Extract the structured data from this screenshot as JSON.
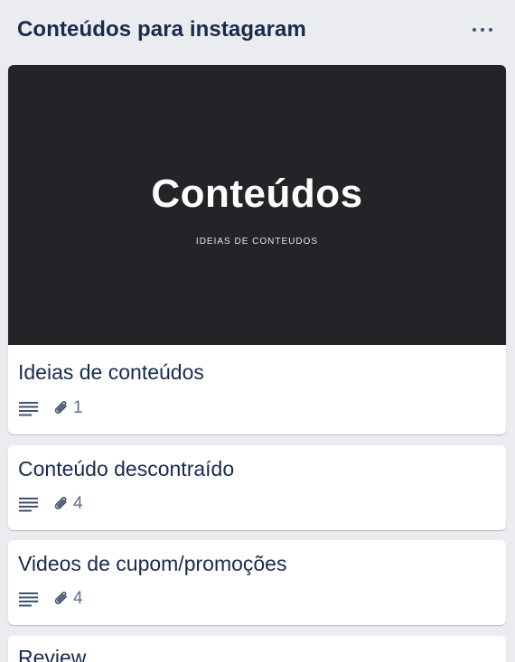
{
  "list": {
    "title": "Conteúdos para instagaram",
    "menu_icon": "more-horizontal-icon"
  },
  "cards": [
    {
      "cover": {
        "title": "Conteúdos",
        "subtitle": "IDEIAS DE CONTEUDOS",
        "background": "#232427"
      },
      "title": "Ideias de conteúdos",
      "attachments": "1"
    },
    {
      "title": "Conteúdo descontraído",
      "attachments": "4"
    },
    {
      "title": "Videos de cupom/promoções",
      "attachments": "4"
    },
    {
      "title": "Review"
    }
  ],
  "icons": {
    "description": "description-lines-icon",
    "attachment": "paperclip-icon"
  },
  "colors": {
    "list_background": "#ebecf0",
    "card_background": "#ffffff",
    "text": "#172b4d",
    "muted_text": "#5e6c84"
  }
}
